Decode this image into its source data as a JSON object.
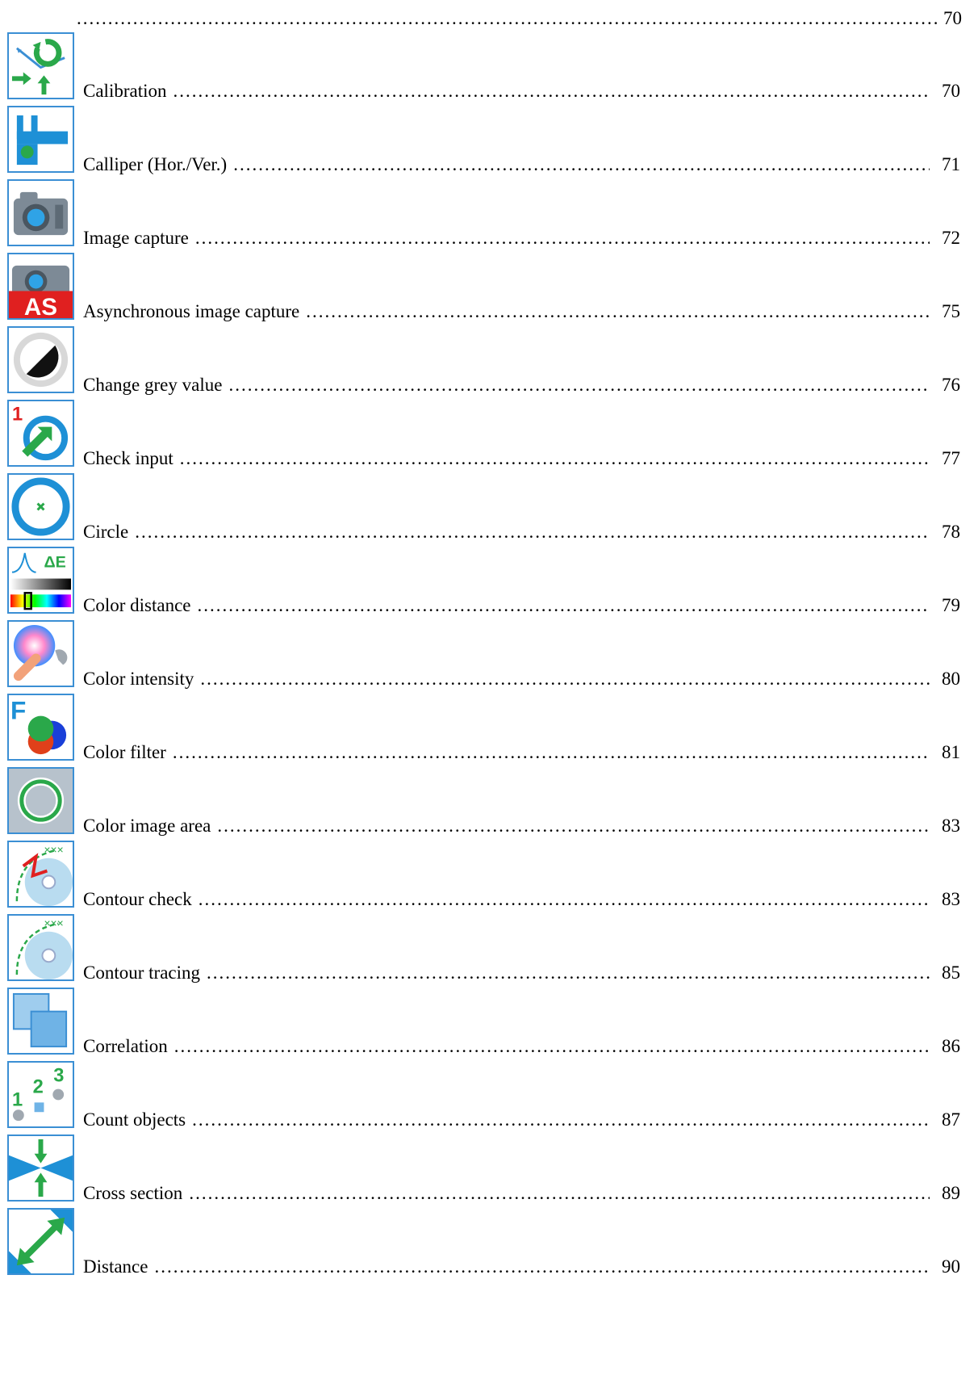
{
  "toc": {
    "top_page_number": "70",
    "entries": [
      {
        "label": "Calibration",
        "page": "70",
        "icon": "calibration-icon"
      },
      {
        "label": "Calliper (Hor./Ver.)",
        "page": "71",
        "icon": "calliper-icon"
      },
      {
        "label": "Image capture",
        "page": "72",
        "icon": "camera-icon"
      },
      {
        "label": "Asynchronous image capture",
        "page": "75",
        "icon": "async-camera-icon"
      },
      {
        "label": "Change grey value",
        "page": "76",
        "icon": "grey-value-icon"
      },
      {
        "label": "Check input",
        "page": "77",
        "icon": "check-input-icon"
      },
      {
        "label": "Circle",
        "page": "78",
        "icon": "circle-icon"
      },
      {
        "label": "Color distance",
        "page": "79",
        "icon": "color-distance-icon"
      },
      {
        "label": "Color intensity",
        "page": "80",
        "icon": "color-intensity-icon"
      },
      {
        "label": "Color filter",
        "page": "81",
        "icon": "color-filter-icon"
      },
      {
        "label": "Color image area",
        "page": "83",
        "icon": "color-image-area-icon"
      },
      {
        "label": "Contour check",
        "page": "83",
        "icon": "contour-check-icon"
      },
      {
        "label": "Contour tracing",
        "page": "85",
        "icon": "contour-tracing-icon"
      },
      {
        "label": "Correlation",
        "page": "86",
        "icon": "correlation-icon"
      },
      {
        "label": "Count objects",
        "page": "87",
        "icon": "count-objects-icon"
      },
      {
        "label": "Cross section",
        "page": "89",
        "icon": "cross-section-icon"
      },
      {
        "label": "Distance",
        "page": "90",
        "icon": "distance-icon"
      }
    ]
  },
  "colors": {
    "icon_border": "#3b8fd4",
    "accent_blue": "#1e90d6",
    "accent_green": "#2aa84a",
    "accent_red": "#e02020"
  }
}
